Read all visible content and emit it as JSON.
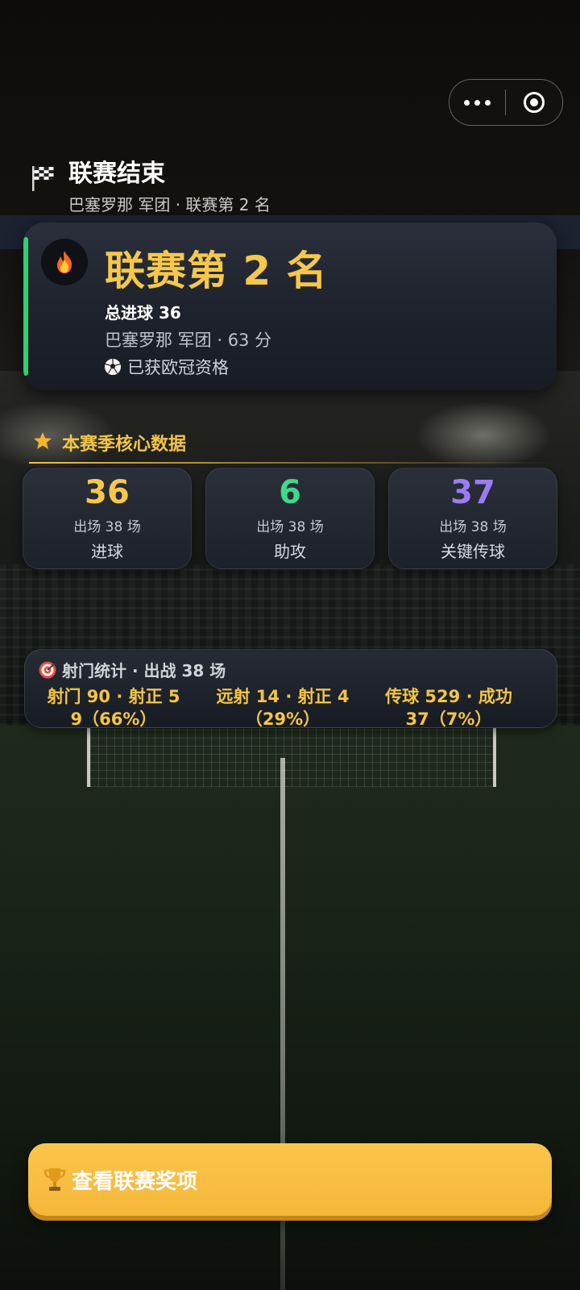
{
  "header": {
    "title": "联赛结束",
    "subtitle": "巴塞罗那 军团 · 联赛第 2 名"
  },
  "rank_card": {
    "title": "联赛第 2 名",
    "goals_line": "总进球 36",
    "team_line": "巴塞罗那 军团 · 63 分",
    "qualification": "已获欧冠资格"
  },
  "season_stats": {
    "title": "本赛季核心数据",
    "items": [
      {
        "value": "36",
        "appearances": "出场 38 场",
        "label": "进球",
        "color": "#f6c84a"
      },
      {
        "value": "6",
        "appearances": "出场 38 场",
        "label": "助攻",
        "color": "#3fd98a"
      },
      {
        "value": "37",
        "appearances": "出场 38 场",
        "label": "关键传球",
        "color": "#9b7cf4"
      }
    ]
  },
  "shooting": {
    "title": "射门统计 · 出战 38 场",
    "columns": [
      {
        "line1": "射门 90 · 射正 5",
        "line2": "9（66%）"
      },
      {
        "line1": "远射 14 · 射正 4",
        "line2": "（29%）"
      },
      {
        "line1": "传球 529 · 成功",
        "line2": "37（7%）"
      }
    ]
  },
  "actions": {
    "awards_label": "查看联赛奖项"
  },
  "icons": {
    "header": "checkered-flag-icon",
    "rank": "fire-icon",
    "ucl": "soccer-ball-icon",
    "section": "star-icon",
    "shooting": "target-icon",
    "awards": "trophy-icon"
  }
}
